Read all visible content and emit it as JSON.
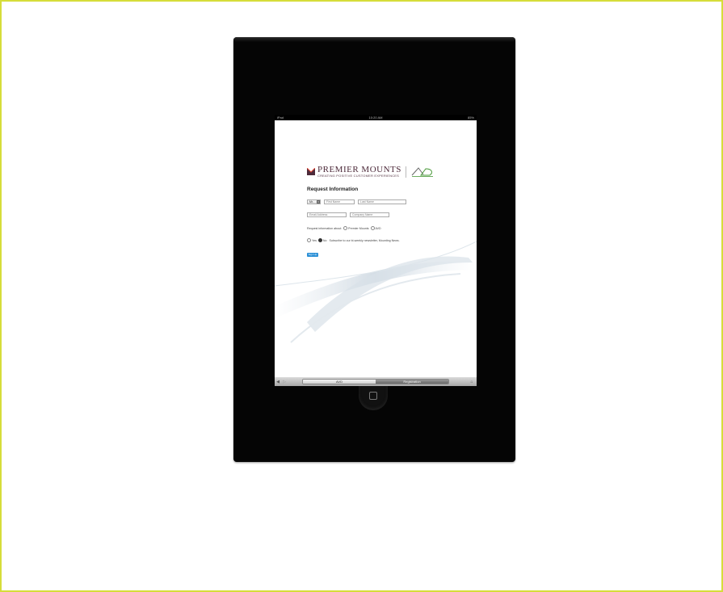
{
  "statusbar": {
    "device": "iPad",
    "time": "10:20 AM",
    "battery": "85%"
  },
  "logos": {
    "brand_name": "PREMIER MOUNTS",
    "brand_tagline": "CREATING POSITIVE CUSTOMER EXPERIENCES",
    "brand_color": "#4d2a3a",
    "avd_color": "#4a9a3a"
  },
  "form": {
    "heading": "Request Information",
    "title_select": "Mr.",
    "first_name_placeholder": "First Name",
    "last_name_placeholder": "Last Name",
    "email_placeholder": "Email Address",
    "company_placeholder": "Company Name",
    "request_label": "Request information about:",
    "request_options": [
      "Premier Mounts",
      "AVD"
    ],
    "newsletter_yes": "Yes",
    "newsletter_no": "No",
    "newsletter_text": "Subscribe to our bi-weekly newsletter, Mounting News.",
    "newsletter_selected": "No",
    "signup_label": "Sign Up",
    "signup_color": "#2a8fd6"
  },
  "toolbar": {
    "tabs": [
      {
        "label": "AVD",
        "active": false
      },
      {
        "label": "Registration",
        "active": true
      }
    ],
    "back_icon": "triangle-left-icon",
    "forward_icon": "triangle-right-icon",
    "home_icon": "home-icon"
  },
  "frame_color": "#d6dd3a"
}
